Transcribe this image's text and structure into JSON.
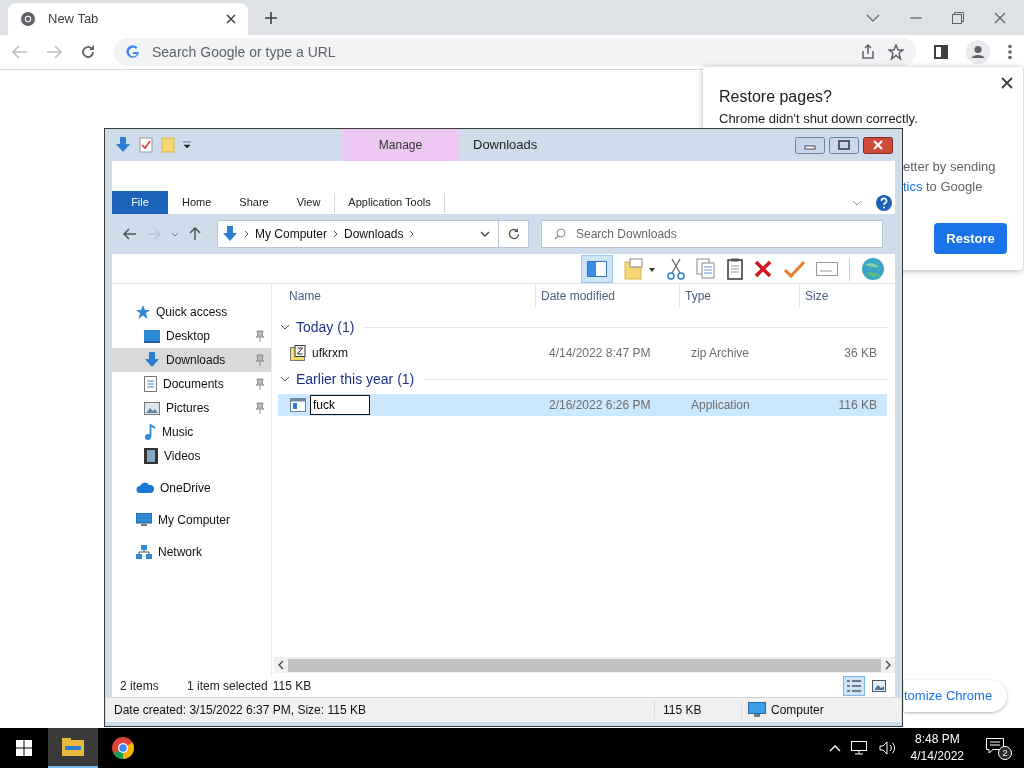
{
  "browser": {
    "tabs": [
      {
        "title": "New Tab",
        "selected": true
      }
    ],
    "address_bar": {
      "placeholder": "Search Google or type a URL"
    }
  },
  "restore_popup": {
    "title": "Restore pages?",
    "message": "Chrome didn't shut down correctly.",
    "line_2": "etter by sending",
    "link": "tics",
    "line_3_rest": "to Google",
    "button": "Restore"
  },
  "customize_button": "tomize Chrome",
  "explorer": {
    "contextual_tab": "Manage",
    "title": "Downloads",
    "ribbon_tabs": [
      {
        "label": "File",
        "kind": "file"
      },
      {
        "label": "Home",
        "kind": "tab"
      },
      {
        "label": "Share",
        "kind": "tab"
      },
      {
        "label": "View",
        "kind": "tab"
      },
      {
        "label": "Application Tools",
        "kind": "contextual"
      }
    ],
    "breadcrumb": [
      "My Computer",
      "Downloads"
    ],
    "search": {
      "placeholder": "Search Downloads"
    },
    "nav": [
      {
        "label": "Quick access",
        "kind": "star",
        "selected": false,
        "pinned": false,
        "children": [
          {
            "label": "Desktop",
            "kind": "desktop",
            "selected": false,
            "pinned": true
          },
          {
            "label": "Downloads",
            "kind": "download",
            "selected": true,
            "pinned": true
          },
          {
            "label": "Documents",
            "kind": "document",
            "selected": false,
            "pinned": true
          },
          {
            "label": "Pictures",
            "kind": "picture",
            "selected": false,
            "pinned": true
          },
          {
            "label": "Music",
            "kind": "music",
            "selected": false,
            "pinned": false
          },
          {
            "label": "Videos",
            "kind": "video",
            "selected": false,
            "pinned": false
          }
        ]
      },
      {
        "label": "OneDrive",
        "kind": "cloud",
        "selected": false,
        "pinned": false
      },
      {
        "label": "My Computer",
        "kind": "computer",
        "selected": false,
        "pinned": false
      },
      {
        "label": "Network",
        "kind": "network",
        "selected": false,
        "pinned": false
      }
    ],
    "columns": [
      "Name",
      "Date modified",
      "Type",
      "Size"
    ],
    "groups": [
      {
        "label": "Today (1)",
        "expanded": true,
        "files": [
          {
            "name": "ufkrxm",
            "kind": "zip",
            "date": "4/14/2022 8:47 PM",
            "type": "zip Archive",
            "size": "36 KB",
            "selected": false,
            "renaming": false
          }
        ]
      },
      {
        "label": "Earlier this year (1)",
        "expanded": true,
        "files": [
          {
            "name": "fuck",
            "kind": "app",
            "date": "2/16/2022 6:26 PM",
            "type": "Application",
            "size": "116 KB",
            "selected": true,
            "renaming": true
          }
        ]
      }
    ],
    "status": {
      "count": "2 items",
      "selection": "1 item selected",
      "selection_size": "115 KB"
    },
    "view_buttons": [
      {
        "kind": "details",
        "selected": true
      },
      {
        "kind": "preview",
        "selected": false
      }
    ],
    "details_bar": {
      "info": "Date created: 3/15/2022 6:37 PM, Size: 115 KB",
      "size": "115 KB",
      "zone": "Computer"
    }
  },
  "taskbar": {
    "apps": [
      {
        "kind": "explorer",
        "selected": true
      },
      {
        "kind": "chrome",
        "selected": false
      }
    ],
    "time": "8:48 PM",
    "date": "4/14/2022",
    "notifications": "2"
  }
}
